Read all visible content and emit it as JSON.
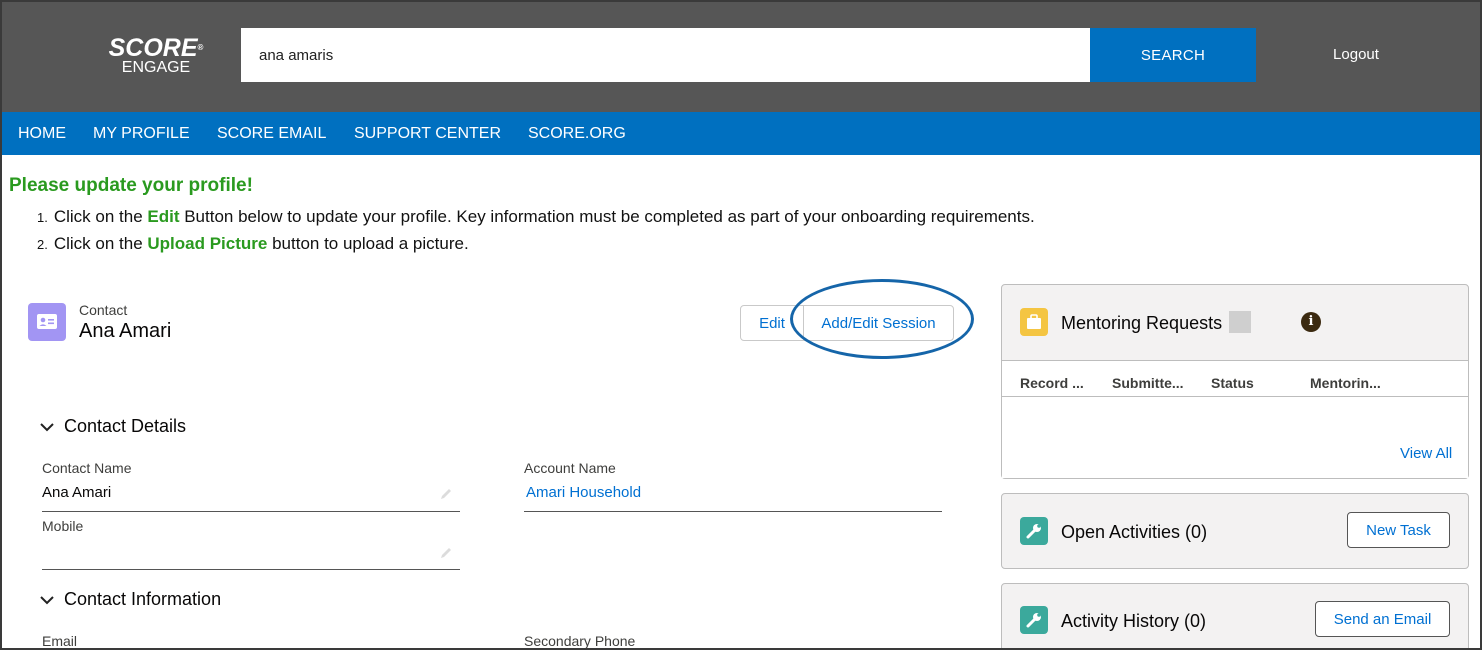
{
  "header": {
    "logo_line1": "SCORE",
    "logo_line2": "ENGAGE",
    "search_value": "ana amaris",
    "search_button": "SEARCH",
    "logout": "Logout"
  },
  "nav": [
    "HOME",
    "MY PROFILE",
    "SCORE EMAIL",
    "SUPPORT CENTER",
    "SCORE.ORG"
  ],
  "notice": {
    "title": "Please update your profile!",
    "item1": {
      "num": "1.",
      "pre": "Click on the ",
      "highlight": "Edit",
      "post": " Button below to update your profile. Key information must be completed as part of your onboarding requirements."
    },
    "item2": {
      "num": "2.",
      "pre": "Click on the ",
      "highlight": "Upload Picture",
      "post": " button to upload a picture."
    }
  },
  "contact": {
    "type_label": "Contact",
    "name": "Ana Amari",
    "edit_button": "Edit",
    "session_button": "Add/Edit Session"
  },
  "contact_details": {
    "heading": "Contact Details",
    "contact_name_label": "Contact Name",
    "contact_name_value": "Ana Amari",
    "account_name_label": "Account Name",
    "account_name_value": "Amari Household",
    "mobile_label": "Mobile",
    "mobile_value": ""
  },
  "contact_information": {
    "heading": "Contact Information",
    "email_label": "Email",
    "secondary_phone_label": "Secondary Phone"
  },
  "mentoring": {
    "title": "Mentoring Requests",
    "columns": [
      "Record ...",
      "Submitte...",
      "Status",
      "Mentorin..."
    ],
    "view_all": "View All"
  },
  "open_activities": {
    "title": "Open Activities (0)",
    "button": "New Task"
  },
  "activity_history": {
    "title": "Activity History (0)",
    "button": "Send an Email"
  },
  "colors": {
    "topbar": "#565656",
    "nav": "#0070c0",
    "notice_green": "#2a9a1f",
    "link_blue": "#0070d2",
    "contact_icon": "#a295f3",
    "mentoring_icon": "#f4c542",
    "activity_icon": "#3ba99c"
  }
}
